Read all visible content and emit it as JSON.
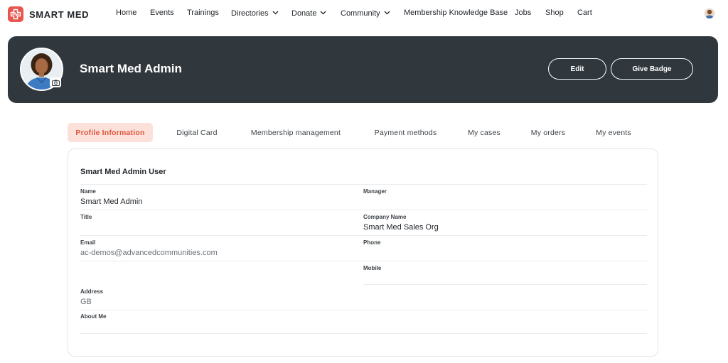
{
  "brand": {
    "name": "SMART MED",
    "color": "#e8554e"
  },
  "nav": {
    "items": [
      {
        "label": "Home",
        "dropdown": false
      },
      {
        "label": "Events",
        "dropdown": false
      },
      {
        "label": "Trainings",
        "dropdown": false
      },
      {
        "label": "Directories",
        "dropdown": true
      },
      {
        "label": "Donate",
        "dropdown": true
      },
      {
        "label": "Community",
        "dropdown": true
      },
      {
        "label": "Membership Knowledge Base",
        "dropdown": false
      },
      {
        "label": "Jobs",
        "dropdown": false
      },
      {
        "label": "Shop",
        "dropdown": false
      },
      {
        "label": "Cart",
        "dropdown": false
      }
    ]
  },
  "header": {
    "name": "Smart Med Admin",
    "edit_label": "Edit",
    "give_badge_label": "Give Badge",
    "background": "#30373d"
  },
  "tabs": [
    {
      "label": "Profile Information",
      "active": true
    },
    {
      "label": "Digital Card",
      "active": false
    },
    {
      "label": "Membership management",
      "active": false
    },
    {
      "label": "Payment methods",
      "active": false
    },
    {
      "label": "My cases",
      "active": false
    },
    {
      "label": "My orders",
      "active": false
    },
    {
      "label": "My events",
      "active": false
    }
  ],
  "profile": {
    "section_title": "Smart Med Admin User",
    "fields": {
      "name": {
        "label": "Name",
        "value": "Smart Med Admin"
      },
      "manager": {
        "label": "Manager",
        "value": ""
      },
      "title": {
        "label": "Title",
        "value": ""
      },
      "company": {
        "label": "Company Name",
        "value": "Smart Med Sales Org"
      },
      "email": {
        "label": "Email",
        "value": "ac-demos@advancedcommunities.com"
      },
      "phone": {
        "label": "Phone",
        "value": ""
      },
      "mobile": {
        "label": "Mobile",
        "value": ""
      },
      "address": {
        "label": "Address",
        "value": "GB"
      },
      "about": {
        "label": "About Me",
        "value": ""
      }
    }
  },
  "accent_tab_bg": "#fbe1da",
  "accent_tab_fg": "#e0553e"
}
